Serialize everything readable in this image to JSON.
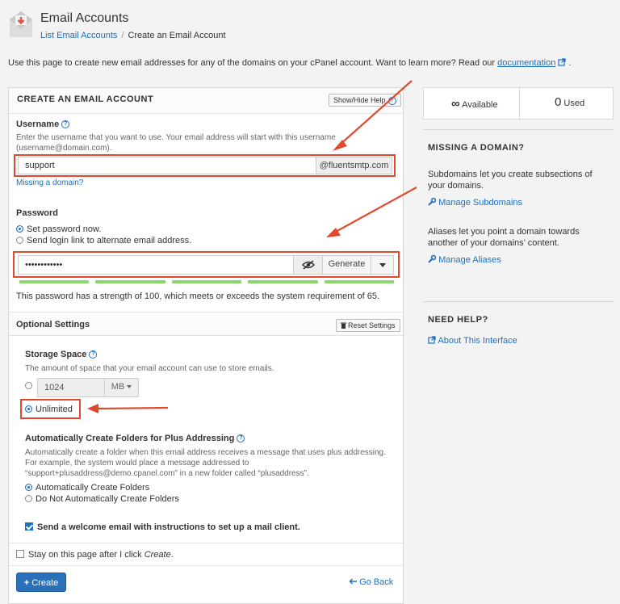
{
  "header": {
    "title": "Email Accounts",
    "breadcrumb_link": "List Email Accounts",
    "breadcrumb_sep": "/",
    "breadcrumb_current": "Create an Email Account"
  },
  "intro": {
    "text": "Use this page to create new email addresses for any of the domains on your cPanel account. Want to learn more? Read our",
    "link": "documentation",
    "trail": "."
  },
  "panel": {
    "title": "CREATE AN EMAIL ACCOUNT",
    "help_button": "Show/Hide Help",
    "username": {
      "label": "Username",
      "help": "Enter the username that you want to use. Your email address will start with this username (username@domain.com).",
      "value": "support",
      "domain": "@fluentsmtp.com",
      "missing_link": "Missing a domain?"
    },
    "password": {
      "label": "Password",
      "option_set": "Set password now.",
      "option_link": "Send login link to alternate email address.",
      "value": "••••••••••••",
      "generate": "Generate",
      "strength_text": "This password has a strength of 100, which meets or exceeds the system requirement of 65."
    },
    "optional": {
      "title": "Optional Settings",
      "reset_button": "Reset Settings",
      "storage_label": "Storage Space",
      "storage_help": "The amount of space that your email account can use to store emails.",
      "storage_value": "1024",
      "storage_unit": "MB",
      "unlimited": "Unlimited",
      "plus_label": "Automatically Create Folders for Plus Addressing",
      "plus_help": "Automatically create a folder when this email address receives a message that uses plus addressing. For example, the system would place a message addressed to “support+plusaddress@demo.cpanel.com” in a new folder called “plusaddress”.",
      "plus_auto": "Automatically Create Folders",
      "plus_no": "Do Not Automatically Create Folders",
      "welcome": "Send a welcome email with instructions to set up a mail client."
    },
    "stay_prefix": "Stay on this page after I click",
    "stay_em": "Create",
    "stay_suffix": ".",
    "create_button": "Create",
    "go_back": "Go Back"
  },
  "side": {
    "available_symbol": "∞",
    "available_label": "Available",
    "used_value": "0",
    "used_label": "Used",
    "missing_heading": "MISSING A DOMAIN?",
    "subdomains_text": "Subdomains let you create subsections of your domains.",
    "subdomains_link": "Manage Subdomains",
    "aliases_text": "Aliases let you point a domain towards another of your domains’ content.",
    "aliases_link": "Manage Aliases",
    "help_heading": "NEED HELP?",
    "about_link": "About This Interface"
  },
  "colors": {
    "accent": "#1d6fbf",
    "highlight": "#e0492c",
    "strength": "#8cd96b",
    "primary_button": "#2a71ba"
  }
}
